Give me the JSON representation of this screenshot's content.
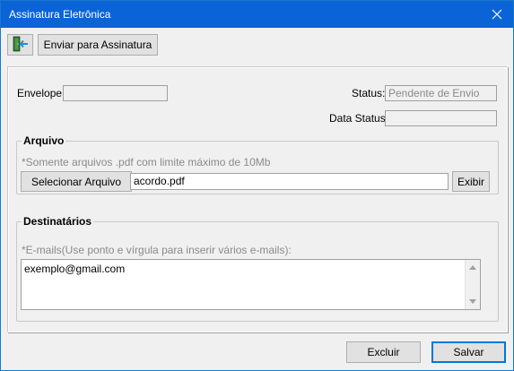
{
  "window": {
    "title": "Assinatura Eletrônica"
  },
  "toolbar": {
    "exit_icon": "exit-door-icon",
    "send_label": "Enviar para Assinatura"
  },
  "envelope": {
    "label": "Envelope:",
    "value": ""
  },
  "status": {
    "label": "Status:",
    "value": "Pendente de Envio"
  },
  "data_status": {
    "label": "Data Status:",
    "value": ""
  },
  "arquivo": {
    "title": "Arquivo",
    "hint": "*Somente arquivos .pdf com limite máximo de 10Mb",
    "select_label": "Selecionar Arquivo",
    "file_value": "acordo.pdf",
    "view_label": "Exibir"
  },
  "destinatarios": {
    "title": "Destinatários",
    "hint": "*E-mails(Use ponto e vírgula para inserir vários e-mails):",
    "emails_value": "exemplo@gmail.com"
  },
  "footer": {
    "delete_label": "Excluir",
    "save_label": "Salvar"
  },
  "colors": {
    "titlebar": "#0a64d8",
    "window_bg": "#f0f0f0"
  }
}
